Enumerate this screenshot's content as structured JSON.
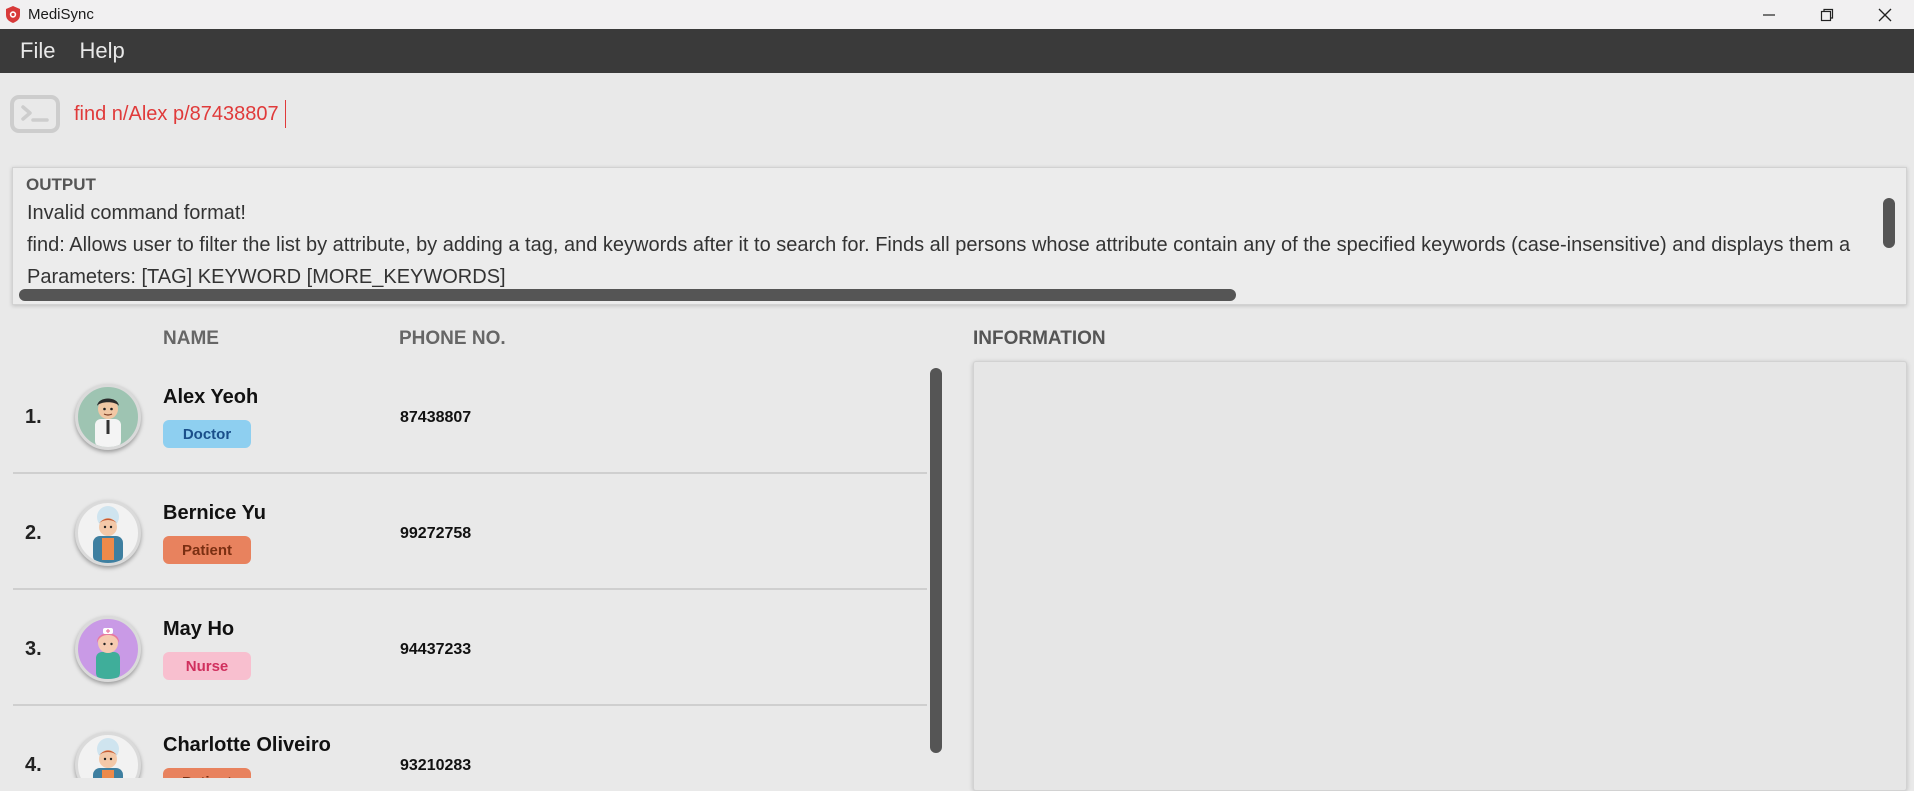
{
  "window": {
    "title": "MediSync",
    "minimize": "—",
    "restore": "❐",
    "close": "✕"
  },
  "menu": {
    "file": "File",
    "help": "Help"
  },
  "command": {
    "value": "find n/Alex p/87438807"
  },
  "output": {
    "label": "OUTPUT",
    "lines": [
      "Invalid command format!",
      "find: Allows user to filter the list by attribute, by adding a tag, and keywords after it to search for. Finds all persons whose attribute contain any of the specified keywords (case-insensitive) and displays them a",
      "Parameters: [TAG] KEYWORD [MORE_KEYWORDS]"
    ]
  },
  "list": {
    "headers": {
      "name": "NAME",
      "phone": "PHONE NO."
    },
    "persons": [
      {
        "index": "1.",
        "name": "Alex Yeoh",
        "tag": "Doctor",
        "phone": "87438807",
        "avatar": "doctor-avatar-icon"
      },
      {
        "index": "2.",
        "name": "Bernice Yu",
        "tag": "Patient",
        "phone": "99272758",
        "avatar": "patient-avatar-icon"
      },
      {
        "index": "3.",
        "name": "May Ho",
        "tag": "Nurse",
        "phone": "94437233",
        "avatar": "nurse-avatar-icon"
      },
      {
        "index": "4.",
        "name": "Charlotte Oliveiro",
        "tag": "Patient",
        "phone": "93210283",
        "avatar": "patient-avatar-icon"
      }
    ]
  },
  "info": {
    "header": "INFORMATION"
  },
  "colors": {
    "doctor_tag_bg": "#8ecff0",
    "doctor_tag_text": "#1a4f8a",
    "patient_tag_bg": "#e8825e",
    "patient_tag_text": "#7a2f12",
    "nurse_tag_bg": "#f8bfcf",
    "nurse_tag_text": "#d0305e",
    "command_text": "#e03a3a"
  }
}
